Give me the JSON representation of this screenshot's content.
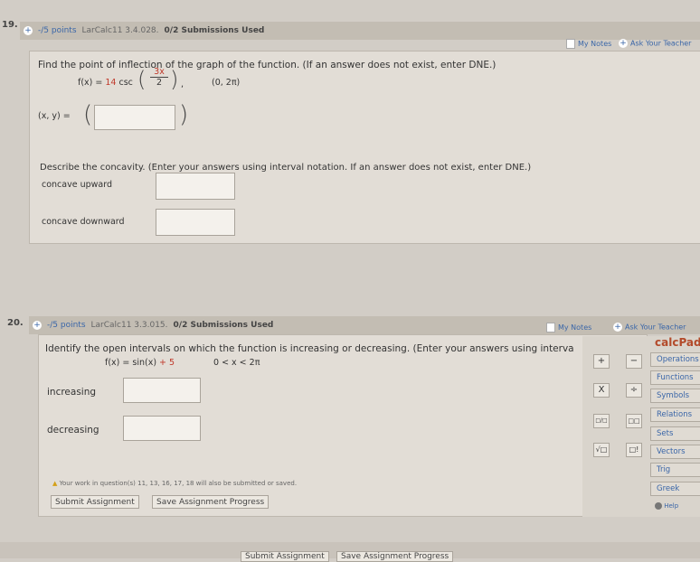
{
  "q19": {
    "number": "19.",
    "points": "-/5 points",
    "source": "LarCalc11 3.4.028.",
    "submissions": "0/2 Submissions Used",
    "my_notes": "My Notes",
    "ask_teacher": "Ask Your Teacher",
    "prompt": "Find the point of inflection of the graph of the function. (If an answer does not exist, enter DNE.)",
    "func_lhs": "f(x) = ",
    "func_coef": "14",
    "func_csc": " csc",
    "frac_num": "3x",
    "frac_den": "2",
    "interval": "(0, 2π)",
    "xy_label": "(x, y) =",
    "xy_value": "",
    "concavity_prompt": "Describe the concavity. (Enter your answers using interval notation. If an answer does not exist, enter DNE.)",
    "up_label": "concave upward",
    "up_value": "",
    "down_label": "concave downward",
    "down_value": ""
  },
  "q20": {
    "number": "20.",
    "points": "-/5 points",
    "source": "LarCalc11 3.3.015.",
    "submissions": "0/2 Submissions Used",
    "my_notes": "My Notes",
    "ask_teacher": "Ask Your Teacher",
    "prompt": "Identify the open intervals on which the function is increasing or decreasing. (Enter your answers using interva",
    "func_lhs": "f(x) = sin(x) ",
    "func_const": "+ 5",
    "domain": "0 < x < 2π",
    "inc_label": "increasing",
    "inc_value": "",
    "dec_label": "decreasing",
    "dec_value": "",
    "warning": "Your work in question(s) 11, 13, 16, 17, 18 will also be submitted or saved.",
    "submit": "Submit Assignment",
    "save": "Save Assignment Progress"
  },
  "calcpad": {
    "title": "calcPad",
    "keys": [
      "+",
      "−",
      "X",
      "÷",
      "□/□",
      "□□",
      "√□",
      "□!"
    ],
    "tabs": [
      "Operations",
      "Functions",
      "Symbols",
      "Relations",
      "Sets",
      "Vectors",
      "Trig",
      "Greek"
    ],
    "help": "Help"
  },
  "footer": {
    "submit": "Submit Assignment",
    "save": "Save Assignment Progress"
  }
}
